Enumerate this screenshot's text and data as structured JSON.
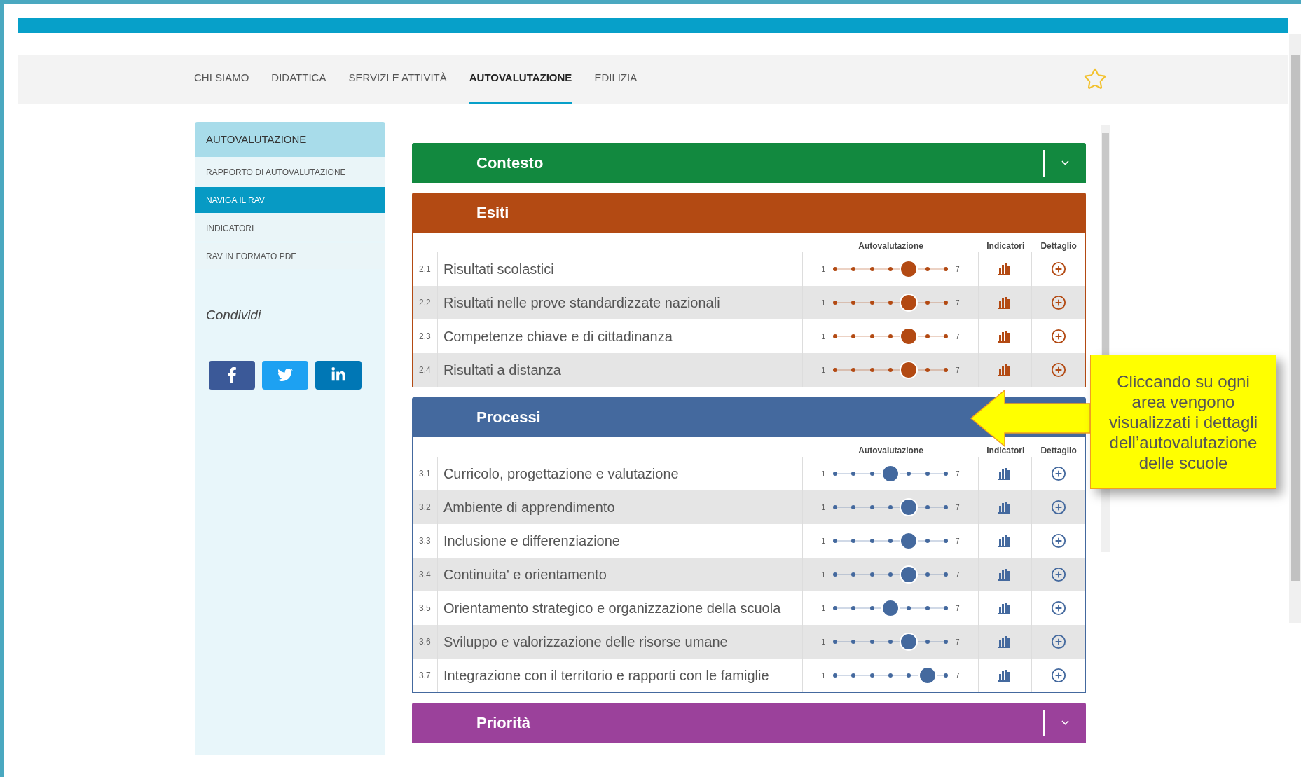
{
  "nav": {
    "items": [
      {
        "label": "CHI SIAMO",
        "selected": false
      },
      {
        "label": "DIDATTICA",
        "selected": false
      },
      {
        "label": "SERVIZI E ATTIVITÀ",
        "selected": false
      },
      {
        "label": "AUTOVALUTAZIONE",
        "selected": true
      },
      {
        "label": "EDILIZIA",
        "selected": false
      }
    ]
  },
  "sidebar": {
    "title": "AUTOVALUTAZIONE",
    "items": [
      {
        "label": "RAPPORTO DI AUTOVALUTAZIONE",
        "selected": false
      },
      {
        "label": "NAVIGA IL RAV",
        "selected": true
      },
      {
        "label": "INDICATORI",
        "selected": false
      },
      {
        "label": "RAV IN FORMATO PDF",
        "selected": false
      }
    ],
    "share_title": "Condividi",
    "share_buttons": [
      {
        "kind": "facebook",
        "color": "#3b5998"
      },
      {
        "kind": "twitter",
        "color": "#1da1f2"
      },
      {
        "kind": "linkedin",
        "color": "#0077b5"
      }
    ]
  },
  "sections": [
    {
      "title": "Contesto",
      "color": "#12893f",
      "expanded": false
    },
    {
      "title": "Esiti",
      "color": "#b34a13",
      "expanded": true,
      "columns": [
        "Autovalutazione",
        "Indicatori",
        "Dettaglio"
      ],
      "rows": [
        {
          "number": "2.1",
          "label": "Risultati scolastici",
          "min": "1",
          "max": "7",
          "level": 0.667
        },
        {
          "number": "2.2",
          "label": "Risultati nelle prove standardizzate nazionali",
          "min": "1",
          "max": "7",
          "level": 0.667
        },
        {
          "number": "2.3",
          "label": "Competenze chiave e di cittadinanza",
          "min": "1",
          "max": "7",
          "level": 0.667
        },
        {
          "number": "2.4",
          "label": "Risultati a distanza",
          "min": "1",
          "max": "7",
          "level": 0.667
        }
      ]
    },
    {
      "title": "Processi",
      "color": "#44699e",
      "expanded": true,
      "columns": [
        "Autovalutazione",
        "Indicatori",
        "Dettaglio"
      ],
      "rows": [
        {
          "number": "3.1",
          "label": "Curricolo, progettazione e valutazione",
          "min": "1",
          "max": "7",
          "level": 0.5
        },
        {
          "number": "3.2",
          "label": "Ambiente di apprendimento",
          "min": "1",
          "max": "7",
          "level": 0.667
        },
        {
          "number": "3.3",
          "label": "Inclusione e differenziazione",
          "min": "1",
          "max": "7",
          "level": 0.667
        },
        {
          "number": "3.4",
          "label": "Continuita' e orientamento",
          "min": "1",
          "max": "7",
          "level": 0.667
        },
        {
          "number": "3.5",
          "label": "Orientamento strategico e organizzazione della scuola",
          "min": "1",
          "max": "7",
          "level": 0.5
        },
        {
          "number": "3.6",
          "label": "Sviluppo e valorizzazione delle risorse umane",
          "min": "1",
          "max": "7",
          "level": 0.667
        },
        {
          "number": "3.7",
          "label": "Integrazione con il territorio e rapporti con le famiglie",
          "min": "1",
          "max": "7",
          "level": 0.833
        }
      ]
    },
    {
      "title": "Priorità",
      "color": "#9b419b",
      "expanded": false
    }
  ],
  "callout": {
    "text": "Cliccando su ogni area vengono visualizzati i dettagli dell’autovalutazione delle scuole"
  }
}
